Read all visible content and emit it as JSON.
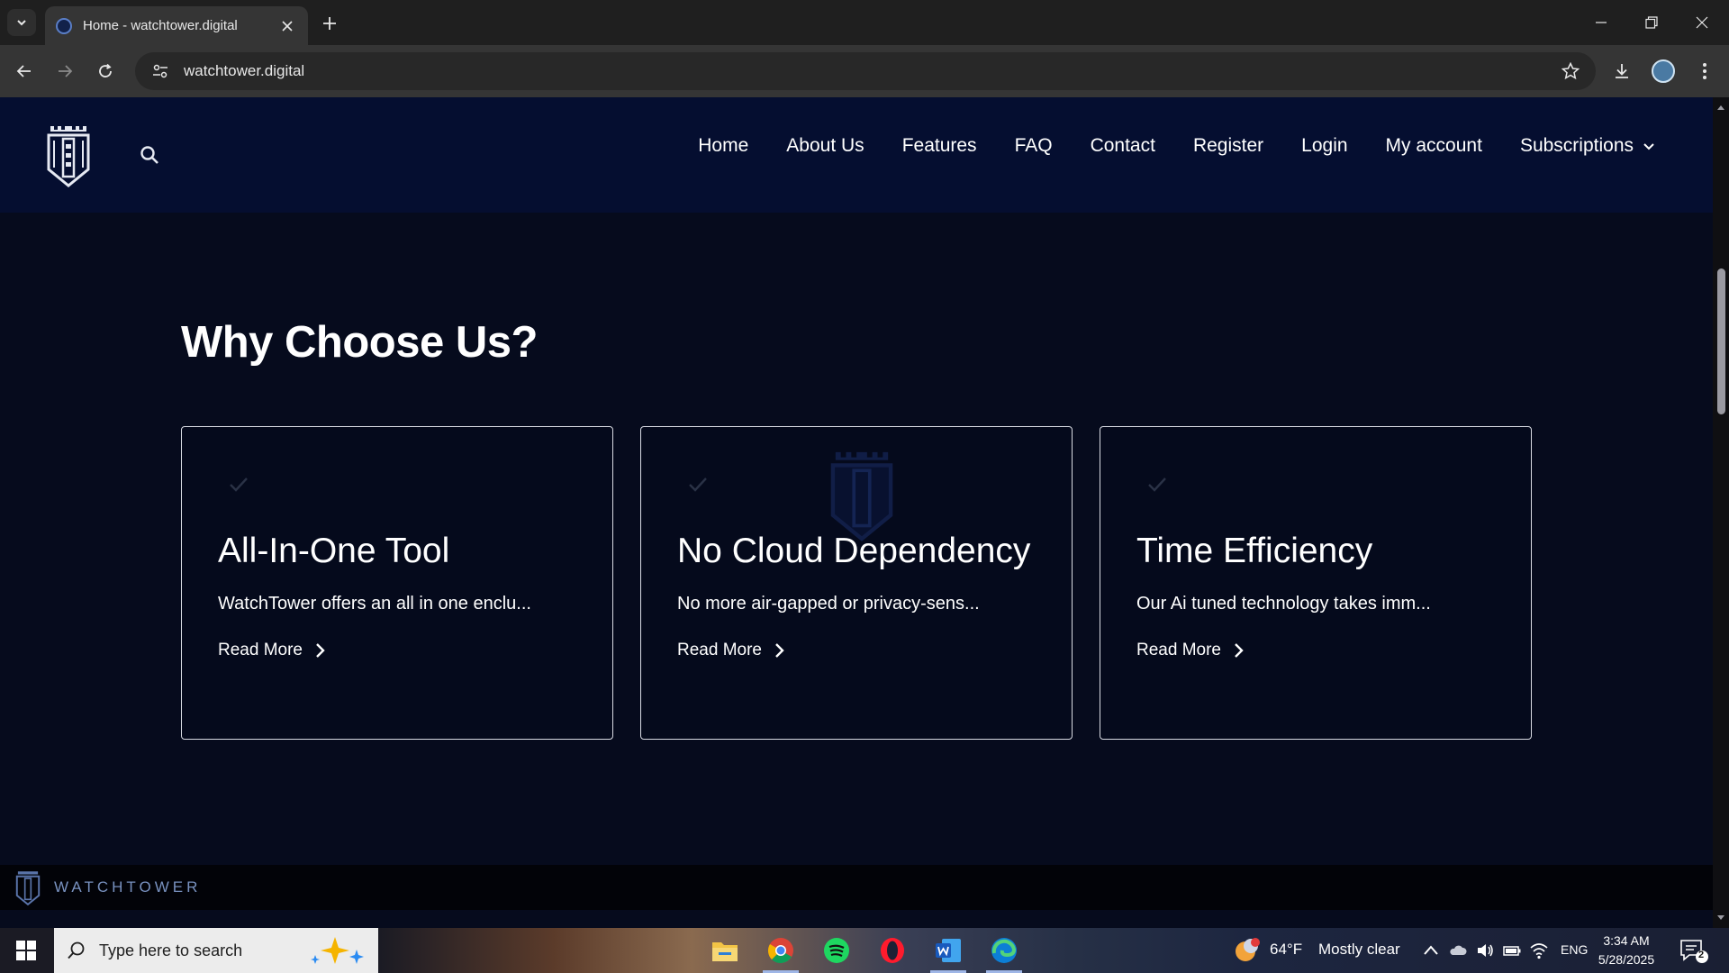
{
  "browser": {
    "tab_title": "Home - watchtower.digital",
    "url": "watchtower.digital"
  },
  "site": {
    "nav": [
      {
        "label": "Home"
      },
      {
        "label": "About Us"
      },
      {
        "label": "Features"
      },
      {
        "label": "FAQ"
      },
      {
        "label": "Contact"
      },
      {
        "label": "Register"
      },
      {
        "label": "Login"
      },
      {
        "label": "My account"
      },
      {
        "label": "Subscriptions"
      }
    ],
    "section_title": "Why Choose Us?",
    "cards": [
      {
        "title": "All-In-One Tool",
        "text": "WatchTower offers an all in one enclu...",
        "link": "Read More"
      },
      {
        "title": "No Cloud Dependency",
        "text": "No more air-gapped or privacy-sens...",
        "link": "Read More"
      },
      {
        "title": "Time Efficiency",
        "text": "Our Ai tuned technology takes imm...",
        "link": "Read More"
      }
    ],
    "footer_brand": "WATCHTOWER"
  },
  "taskbar": {
    "search_placeholder": "Type here to search",
    "weather_temp": "64°F",
    "weather_desc": "Mostly clear",
    "language": "ENG",
    "time": "3:34 AM",
    "date": "5/28/2025",
    "notification_count": "2"
  },
  "colors": {
    "header_bg": "#050e30",
    "page_bg": "#060b1d",
    "card_border": "#d9dbe3",
    "brand_text": "#7891bf"
  }
}
